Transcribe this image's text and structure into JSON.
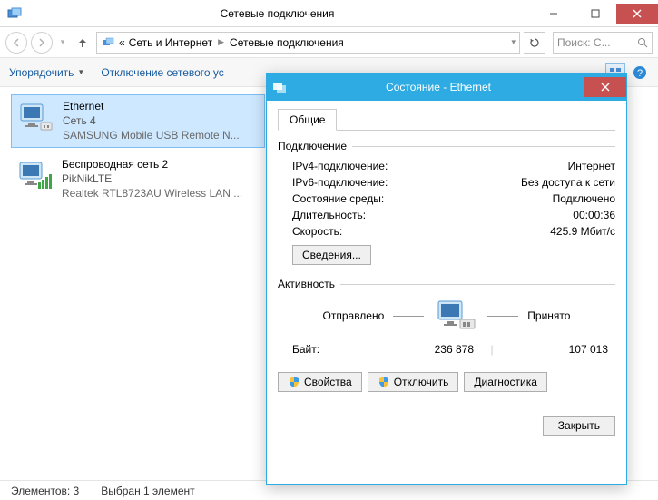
{
  "window": {
    "title": "Сетевые подключения",
    "search_placeholder": "Поиск: С..."
  },
  "breadcrumb": {
    "root": "Сеть и Интернет",
    "leaf": "Сетевые подключения",
    "prefix": "«"
  },
  "toolbar": {
    "organize": "Упорядочить",
    "disable": "Отключение сетевого ус"
  },
  "connections": [
    {
      "name": "Ethernet",
      "subtitle": "Сеть 4",
      "adapter": "SAMSUNG Mobile USB Remote N...",
      "selected": true,
      "iconType": "ethernet"
    },
    {
      "name": "Беспроводная сеть 2",
      "subtitle": "PikNikLTE",
      "adapter": "Realtek RTL8723AU Wireless LAN ...",
      "selected": false,
      "iconType": "wifi"
    }
  ],
  "statusbar": {
    "items": "Элементов: 3",
    "selected": "Выбран 1 элемент"
  },
  "dialog": {
    "title": "Состояние - Ethernet",
    "tab_general": "Общие",
    "group_connection": "Подключение",
    "ipv4_label": "IPv4-подключение:",
    "ipv4_value": "Интернет",
    "ipv6_label": "IPv6-подключение:",
    "ipv6_value": "Без доступа к сети",
    "media_label": "Состояние среды:",
    "media_value": "Подключено",
    "duration_label": "Длительность:",
    "duration_value": "00:00:36",
    "speed_label": "Скорость:",
    "speed_value": "425.9 Мбит/с",
    "details_btn": "Сведения...",
    "group_activity": "Активность",
    "sent_label": "Отправлено",
    "recv_label": "Принято",
    "bytes_label": "Байт:",
    "bytes_sent": "236 878",
    "bytes_recv": "107 013",
    "properties_btn": "Свойства",
    "disable_btn": "Отключить",
    "diagnose_btn": "Диагностика",
    "close_btn": "Закрыть"
  }
}
